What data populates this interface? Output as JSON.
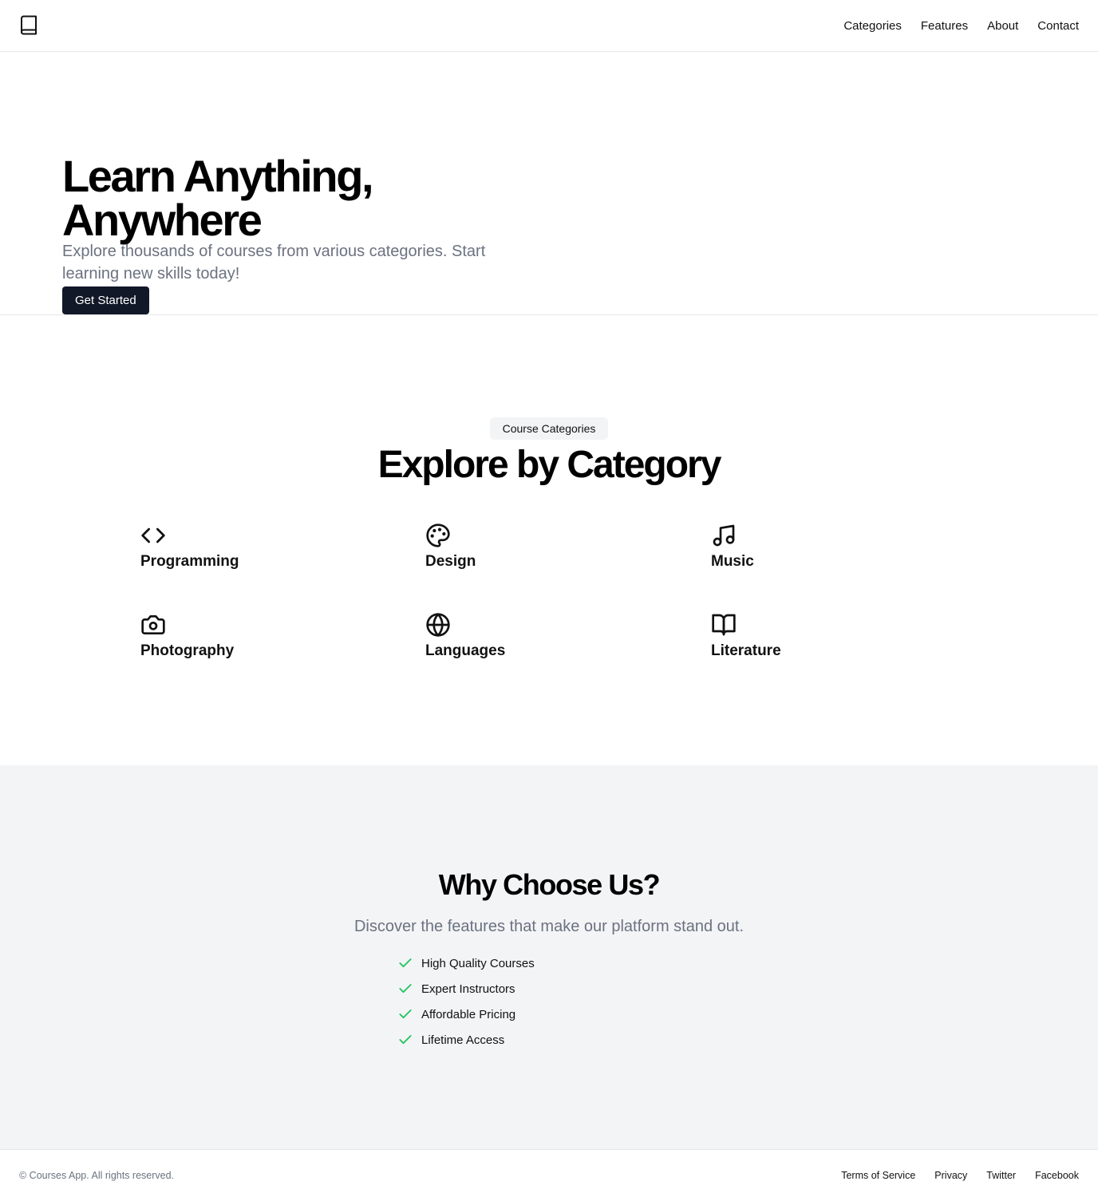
{
  "header": {
    "logo_icon": "book-icon",
    "nav": [
      {
        "label": "Categories"
      },
      {
        "label": "Features"
      },
      {
        "label": "About"
      },
      {
        "label": "Contact"
      }
    ]
  },
  "hero": {
    "title": "Learn Anything, Anywhere",
    "subtitle": "Explore thousands of courses from various categories. Start learning new skills today!",
    "cta_label": "Get Started"
  },
  "categories": {
    "badge": "Course Categories",
    "title": "Explore by Category",
    "items": [
      {
        "label": "Programming",
        "icon": "code-icon"
      },
      {
        "label": "Design",
        "icon": "palette-icon"
      },
      {
        "label": "Music",
        "icon": "music-note-icon"
      },
      {
        "label": "Photography",
        "icon": "camera-icon"
      },
      {
        "label": "Languages",
        "icon": "globe-icon"
      },
      {
        "label": "Literature",
        "icon": "open-book-icon"
      }
    ]
  },
  "why": {
    "title": "Why Choose Us?",
    "subtitle": "Discover the features that make our platform stand out.",
    "check_color": "#22c55e",
    "features": [
      {
        "label": "High Quality Courses"
      },
      {
        "label": "Expert Instructors"
      },
      {
        "label": "Affordable Pricing"
      },
      {
        "label": "Lifetime Access"
      }
    ]
  },
  "footer": {
    "copyright": "© Courses App. All rights reserved.",
    "links": [
      {
        "label": "Terms of Service"
      },
      {
        "label": "Privacy"
      },
      {
        "label": "Twitter"
      },
      {
        "label": "Facebook"
      }
    ]
  },
  "colors": {
    "primary_button": "#111827",
    "muted_text": "#6b7280",
    "section_bg": "#f3f4f6"
  }
}
